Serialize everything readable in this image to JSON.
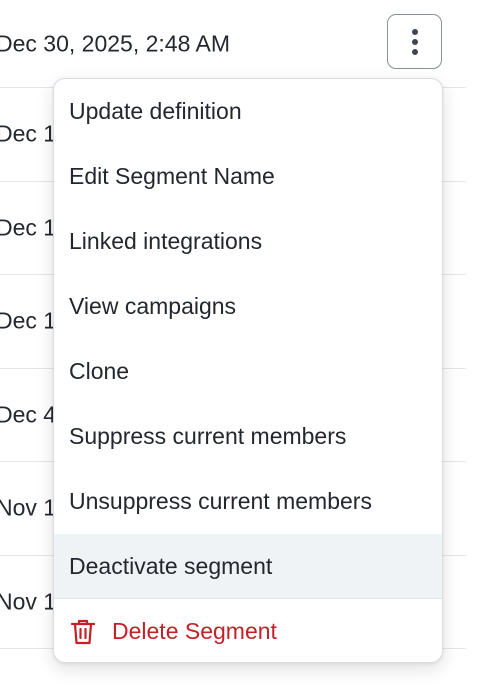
{
  "table": {
    "rows": [
      {
        "date": "Dec 30, 2025, 2:48 AM"
      },
      {
        "date": "Dec 1"
      },
      {
        "date": "Dec 1"
      },
      {
        "date": "Dec 1"
      },
      {
        "date": "Dec 4"
      },
      {
        "date": "Nov 1"
      },
      {
        "date": "Nov 1"
      }
    ]
  },
  "actions_menu": {
    "trigger_icon": "kebab-vertical-icon",
    "items": [
      {
        "label": "Update definition"
      },
      {
        "label": "Edit Segment Name"
      },
      {
        "label": "Linked integrations"
      },
      {
        "label": "View campaigns"
      },
      {
        "label": "Clone"
      },
      {
        "label": "Suppress current members"
      },
      {
        "label": "Unsuppress current members"
      },
      {
        "label": "Deactivate segment",
        "highlighted": true
      }
    ],
    "danger_item": {
      "label": "Delete Segment",
      "icon": "trash-icon",
      "color": "#c42127"
    }
  },
  "colors": {
    "highlight": "#f0f3f5",
    "danger": "#c42127",
    "border": "#d9dde2"
  }
}
